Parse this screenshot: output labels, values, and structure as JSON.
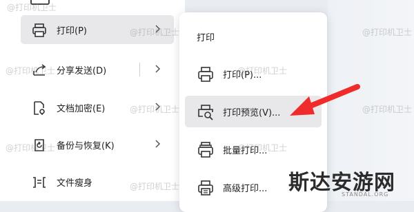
{
  "left_menu": {
    "items": [
      {
        "label": "打印(P)",
        "icon": "printer-icon"
      },
      {
        "label": "分享发送(D)",
        "icon": "share-icon"
      },
      {
        "label": "文档加密(E)",
        "icon": "document-lock-icon"
      },
      {
        "label": "备份与恢复(K)",
        "icon": "backup-icon"
      },
      {
        "label": "文件瘦身",
        "icon": "file-slim-icon"
      }
    ]
  },
  "submenu": {
    "title": "打印",
    "items": [
      {
        "label": "打印(P)...",
        "icon": "printer-icon"
      },
      {
        "label": "打印预览(V)...",
        "icon": "print-preview-icon"
      },
      {
        "label": "批量打印...",
        "icon": "batch-print-icon"
      },
      {
        "label": "高级打印...",
        "icon": "advanced-print-icon"
      }
    ]
  },
  "watermark": "@打印机卫士",
  "brand": {
    "name": "斯达安游网",
    "domain": "STANDAL.ORG"
  },
  "colors": {
    "arrow": "#ef2b2b",
    "hover_bg": "#e8e8ea"
  }
}
